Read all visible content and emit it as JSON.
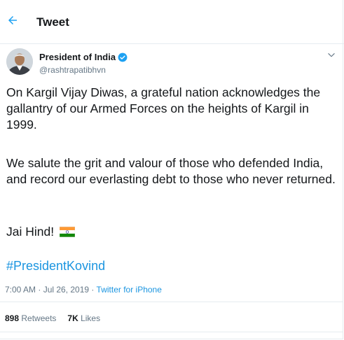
{
  "header": {
    "title": "Tweet",
    "back_icon": "arrow-left-icon"
  },
  "author": {
    "name": "President of India",
    "handle": "@rashtrapatibhvn",
    "verified_icon": "verified-badge-icon",
    "menu_icon": "chevron-down-icon"
  },
  "tweet": {
    "paragraph_1": "On Kargil Vijay Diwas, a grateful nation acknowledges the gallantry of our Armed Forces on the heights of Kargil in 1999.",
    "paragraph_2": "We salute the grit and valour of those who defended India, and record our everlasting debt to those who never returned.",
    "paragraph_3": "Jai Hind!",
    "flag_icon": "india-flag-icon",
    "hashtag": "#PresidentKovind",
    "timestamp": "7:00 AM · Jul 26, 2019 · ",
    "source": "Twitter for iPhone"
  },
  "stats": {
    "retweets_count": "898",
    "retweets_label": "Retweets",
    "likes_count": "7K",
    "likes_label": "Likes"
  },
  "colors": {
    "accent": "#1b95e0",
    "secondary_text": "#657786",
    "border": "#e6ecf0"
  }
}
